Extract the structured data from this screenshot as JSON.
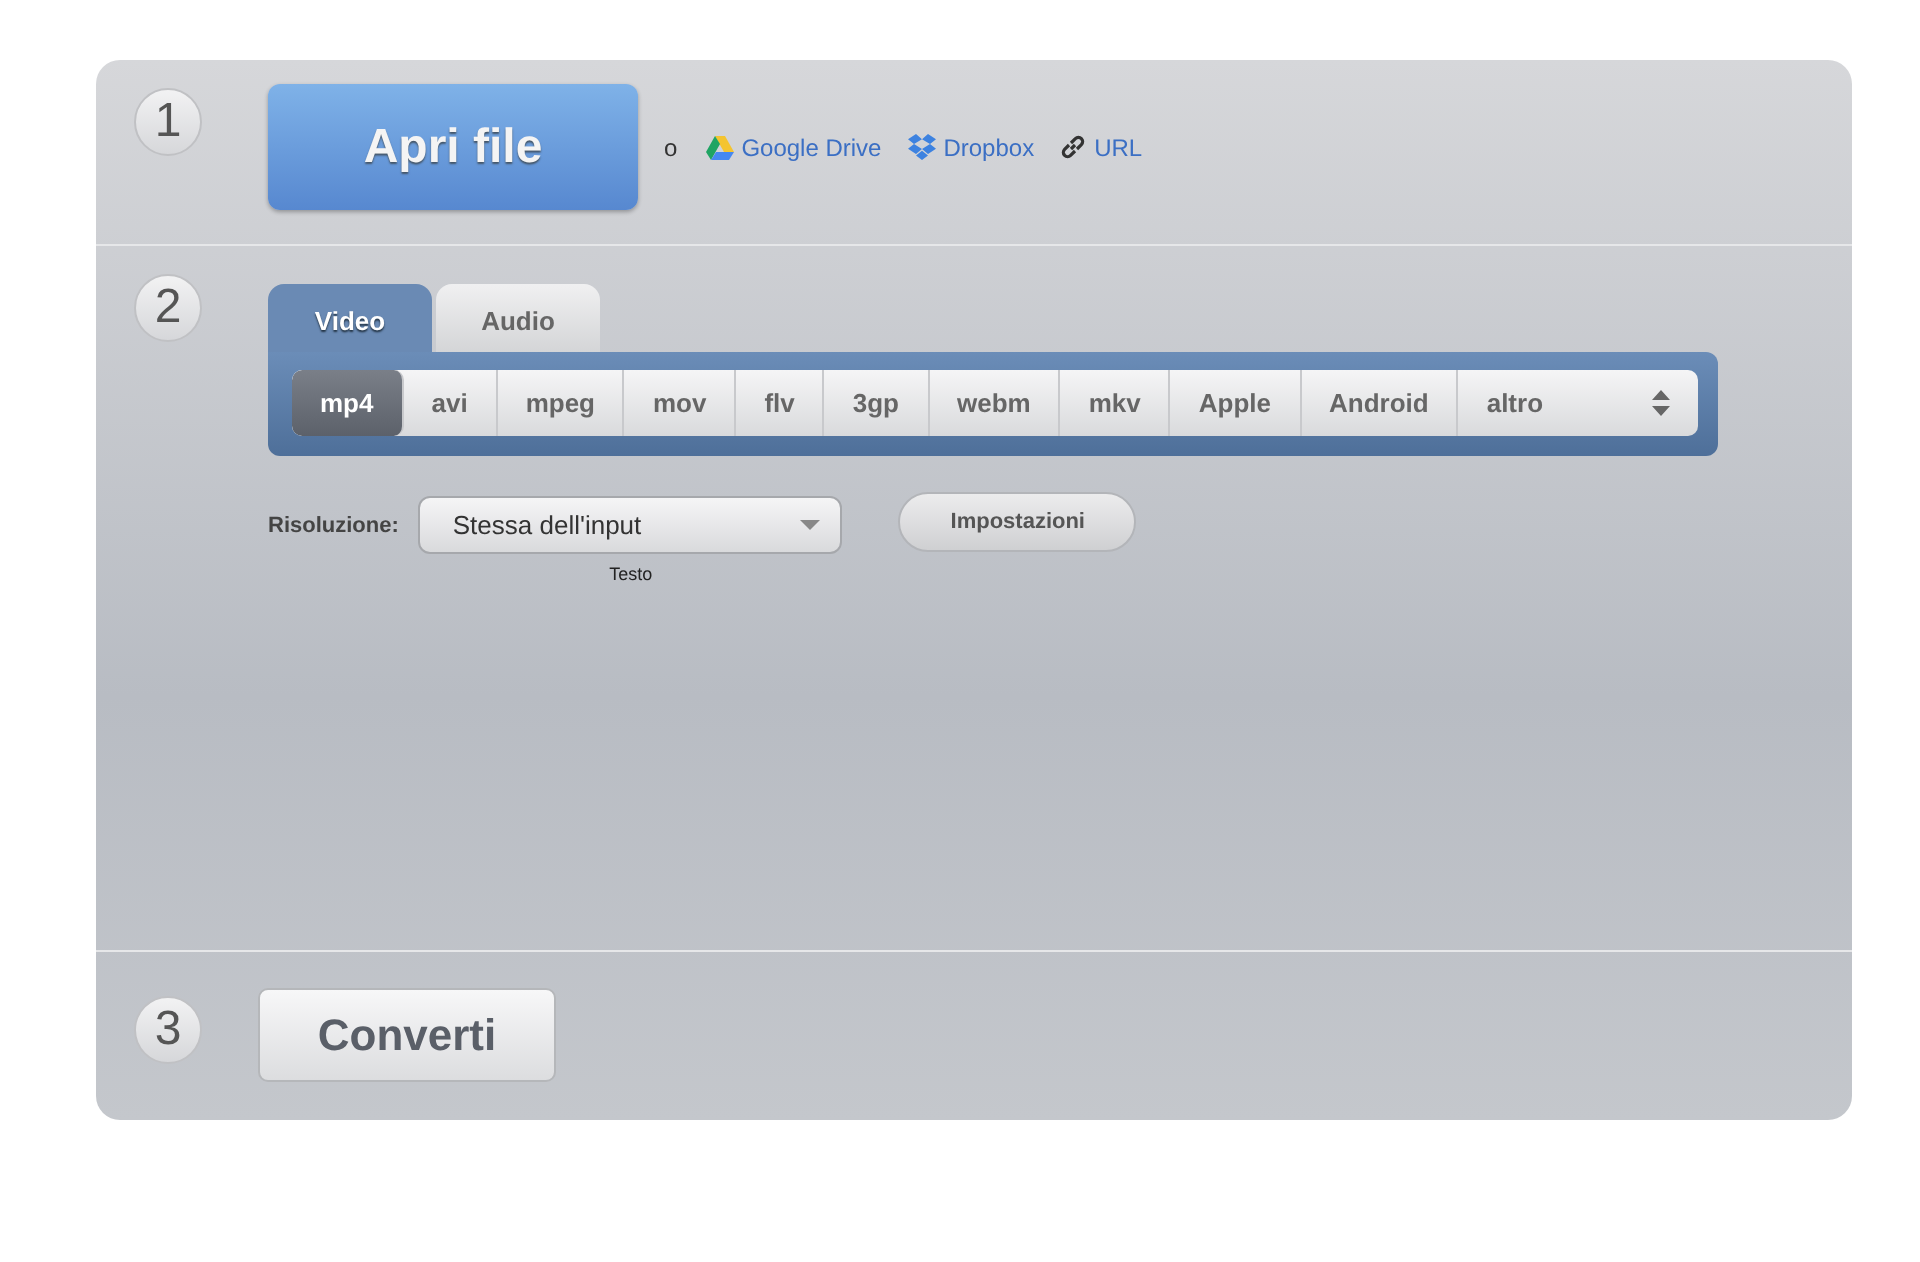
{
  "steps": [
    {
      "number": "1",
      "kind": "open"
    },
    {
      "number": "2",
      "kind": "format"
    },
    {
      "number": "3",
      "kind": "convert"
    }
  ],
  "open": {
    "button": "Apri file",
    "or": "o",
    "sources": [
      {
        "kind": "drive",
        "label": "Google Drive"
      },
      {
        "kind": "dropbox",
        "label": "Dropbox"
      },
      {
        "kind": "url",
        "label": "URL"
      }
    ]
  },
  "tabs": [
    {
      "label": "Video",
      "selected": true
    },
    {
      "label": "Audio",
      "selected": false
    }
  ],
  "formats": [
    {
      "label": "mp4",
      "kind": "format",
      "selected": true
    },
    {
      "label": "avi",
      "kind": "format",
      "selected": false
    },
    {
      "label": "mpeg",
      "kind": "format",
      "selected": false
    },
    {
      "label": "mov",
      "kind": "format",
      "selected": false
    },
    {
      "label": "flv",
      "kind": "format",
      "selected": false
    },
    {
      "label": "3gp",
      "kind": "format",
      "selected": false
    },
    {
      "label": "webm",
      "kind": "format",
      "selected": false
    },
    {
      "label": "mkv",
      "kind": "format",
      "selected": false
    },
    {
      "label": "Apple",
      "kind": "format",
      "selected": false
    },
    {
      "label": "Android",
      "kind": "format",
      "selected": false
    },
    {
      "label": "altro",
      "kind": "dropdown",
      "selected": false
    }
  ],
  "resolution": {
    "label": "Risoluzione:",
    "value": "Stessa dell'input",
    "caption": "Testo"
  },
  "settings_button": "Impostazioni",
  "convert_button": "Converti"
}
